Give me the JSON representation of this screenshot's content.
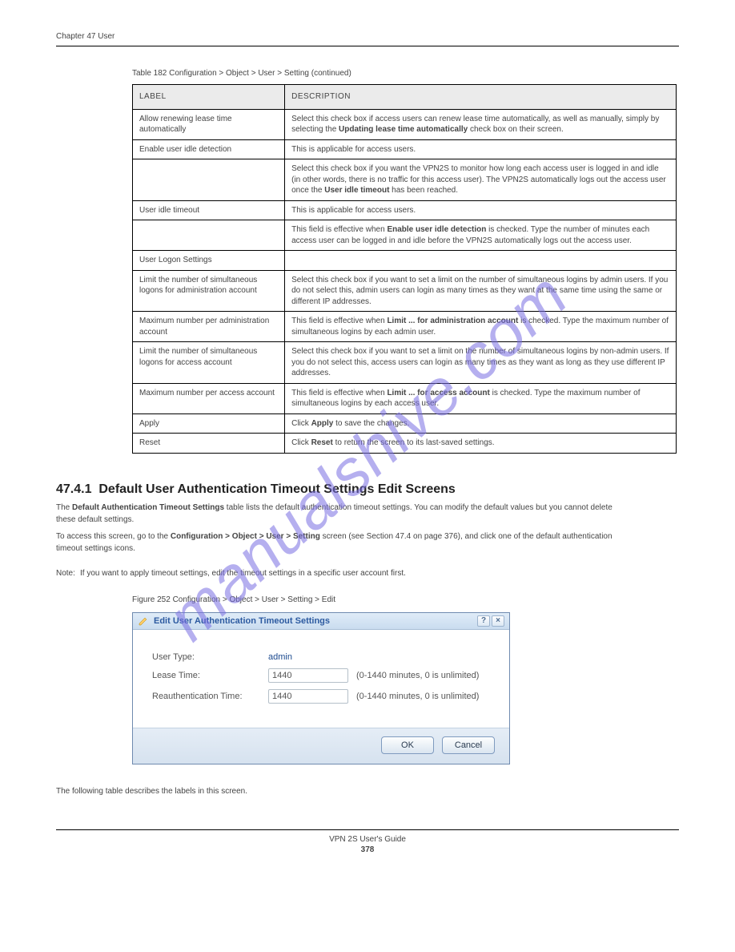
{
  "header": {
    "chapter": "Chapter 47 User",
    "product": "VPN 2S User's Guide"
  },
  "table": {
    "caption": "Table 182   Configuration > Object > User > Setting (continued)",
    "headers": [
      "LABEL",
      "DESCRIPTION"
    ],
    "rows": [
      {
        "label": "Allow renewing lease time automatically",
        "desc": "Select this check box if access users can renew lease time automatically, as well as manually, simply by selecting the <b>Updating lease time automatically</b> check box on their screen."
      },
      {
        "label": "Enable user idle detection",
        "desc": "This is applicable for access users."
      },
      {
        "label": "",
        "desc": "Select this check box if you want the VPN2S to monitor how long each access user is logged in and idle (in other words, there is no traffic for this access user). The VPN2S automatically logs out the access user once the <b>User idle timeout</b> has been reached."
      },
      {
        "label": "User idle timeout",
        "desc": "This is applicable for access users."
      },
      {
        "label": "",
        "desc": "This field is effective when <b>Enable user idle detection</b> is checked. Type the number of minutes each access user can be logged in and idle before the VPN2S automatically logs out the access user."
      },
      {
        "label": "User Logon Settings",
        "desc": ""
      },
      {
        "label": "Limit the number of simultaneous logons for administration account",
        "desc": "Select this check box if you want to set a limit on the number of simultaneous logins by admin users. If you do not select this, admin users can login as many times as they want at the same time using the same or different IP addresses."
      },
      {
        "label": "Maximum number per administration account",
        "desc": "This field is effective when <b>Limit ... for administration account</b> is checked. Type the maximum number of simultaneous logins by each admin user."
      },
      {
        "label": "Limit the number of simultaneous logons for access account",
        "desc": "Select this check box if you want to set a limit on the number of simultaneous logins by non-admin users. If you do not select this, access users can login as many times as they want as long as they use different IP addresses."
      },
      {
        "label": "Maximum number per access account",
        "desc": "This field is effective when <b>Limit ... for access account</b> is checked. Type the maximum number of simultaneous logins by each access user."
      },
      {
        "label": "Apply",
        "desc": "Click <b>Apply</b> to save the changes."
      },
      {
        "label": "Reset",
        "desc": "Click <b>Reset</b> to return the screen to its last-saved settings."
      }
    ]
  },
  "section": {
    "number": "47.4.1",
    "title": "Default User Authentication Timeout Settings Edit Screens",
    "body1_prefix": "The ",
    "body1_bold": "Default Authentication Timeout Settings",
    "body1_suffix": " table lists the default authentication timeout settings. You can modify the default values but you cannot delete these default settings.",
    "body2_prefix": "To access this screen, go to the ",
    "body2_bold": "Configuration > Object > User > Setting",
    "body2_suffix": " screen (see Section 47.4 on page 376), and click one of the default authentication timeout settings icons.",
    "note_prefix": "Note:",
    "note_body": "If you want to apply timeout settings, edit the timeout settings in a specific user account first."
  },
  "figure": {
    "caption": "Figure 252   Configuration > Object > User > Setting > Edit",
    "dialog_title": "Edit User Authentication Timeout Settings",
    "rows": {
      "usertype_label": "User Type:",
      "usertype_value": "admin",
      "leasetime_label": "Lease Time:",
      "leasetime_value": "1440",
      "leasetime_hint": "(0-1440 minutes, 0 is unlimited)",
      "reauth_label": "Reauthentication Time:",
      "reauth_value": "1440",
      "reauth_hint": "(0-1440 minutes, 0 is unlimited)"
    },
    "buttons": {
      "ok": "OK",
      "cancel": "Cancel"
    }
  },
  "aftertext": "The following table describes the labels in this screen.",
  "footer": {
    "pagenum": "378"
  },
  "watermark": "manualshive.com"
}
